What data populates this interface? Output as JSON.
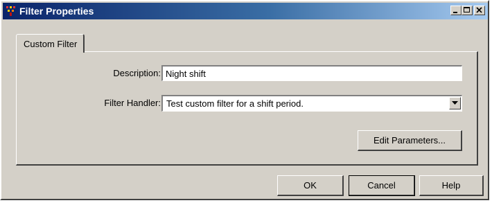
{
  "window": {
    "title": "Filter Properties",
    "app_icon": "filter-properties-app-icon",
    "caption_buttons": [
      "minimize",
      "maximize",
      "close"
    ]
  },
  "tabs": [
    {
      "label": "Custom Filter",
      "selected": true
    }
  ],
  "form": {
    "description_label": "Description:",
    "description_value": "Night shift",
    "handler_label": "Filter Handler:",
    "handler_value": "Test custom filter for a shift period.",
    "edit_parameters_label": "Edit Parameters..."
  },
  "buttons": {
    "ok": "OK",
    "cancel": "Cancel",
    "help": "Help"
  },
  "colors": {
    "face": "#d4d0c8",
    "titlebar_start": "#0a246a",
    "titlebar_end": "#a6caf0"
  }
}
